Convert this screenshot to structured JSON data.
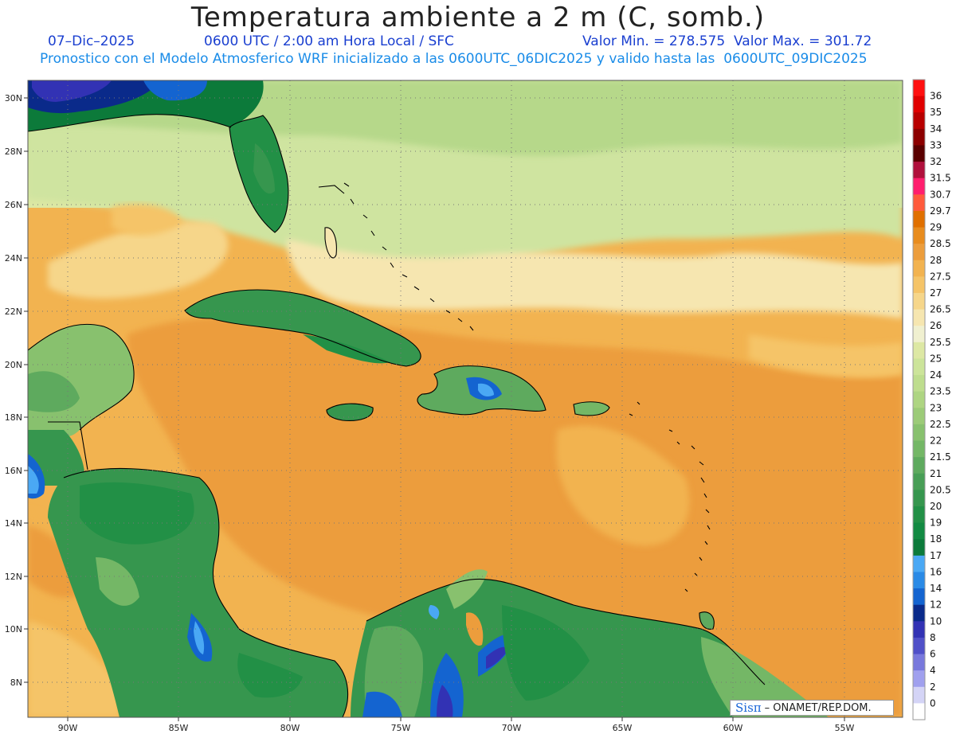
{
  "header": {
    "title": "Temperatura ambiente a 2 m (C, somb.)",
    "date": "07–Dic–2025",
    "time": "0600 UTC / 2:00 am Hora Local / SFC",
    "minmax": "Valor Min. = 278.575  Valor Max. = 301.72",
    "model_line": "Pronostico con el Modelo Atmosferico WRF inicializado a las 0600UTC_06DIC2025 y valido hasta las  0600UTC_09DIC2025"
  },
  "map": {
    "lat_labels": [
      "30N",
      "28N",
      "26N",
      "24N",
      "22N",
      "20N",
      "18N",
      "16N",
      "14N",
      "12N",
      "10N",
      "8N"
    ],
    "lon_labels": [
      "90W",
      "85W",
      "80W",
      "75W",
      "70W",
      "65W",
      "60W",
      "55W"
    ]
  },
  "colorbar": {
    "levels": [
      {
        "label": "36",
        "color": "#ff1010"
      },
      {
        "label": "35",
        "color": "#e00000"
      },
      {
        "label": "34",
        "color": "#b80000"
      },
      {
        "label": "33",
        "color": "#8c0000"
      },
      {
        "label": "32",
        "color": "#5a0000"
      },
      {
        "label": "31.5",
        "color": "#b0103c"
      },
      {
        "label": "30.7",
        "color": "#ff1e6e"
      },
      {
        "label": "29.7",
        "color": "#ff5a3c"
      },
      {
        "label": "29",
        "color": "#e07000"
      },
      {
        "label": "28.5",
        "color": "#e88c1e"
      },
      {
        "label": "28",
        "color": "#ec9d3c"
      },
      {
        "label": "27.5",
        "color": "#f2b350"
      },
      {
        "label": "27",
        "color": "#f5c468"
      },
      {
        "label": "26.5",
        "color": "#f6d68a"
      },
      {
        "label": "26",
        "color": "#f6e6b0"
      },
      {
        "label": "25.5",
        "color": "#f0f0d0"
      },
      {
        "label": "25",
        "color": "#dde8a4"
      },
      {
        "label": "24",
        "color": "#cce49a"
      },
      {
        "label": "23.5",
        "color": "#bedd8e"
      },
      {
        "label": "23",
        "color": "#aed582"
      },
      {
        "label": "22.5",
        "color": "#9ccb78"
      },
      {
        "label": "22",
        "color": "#88c16e"
      },
      {
        "label": "21.5",
        "color": "#74b766"
      },
      {
        "label": "21",
        "color": "#5eaa5e"
      },
      {
        "label": "20.5",
        "color": "#489e56"
      },
      {
        "label": "20",
        "color": "#36964e"
      },
      {
        "label": "19",
        "color": "#229046"
      },
      {
        "label": "18",
        "color": "#128a42"
      },
      {
        "label": "17",
        "color": "#0c7a3a"
      },
      {
        "label": "16",
        "color": "#4aa8f4"
      },
      {
        "label": "14",
        "color": "#2a8ae6"
      },
      {
        "label": "12",
        "color": "#1464d0"
      },
      {
        "label": "10",
        "color": "#0a2a8a"
      },
      {
        "label": "8",
        "color": "#3232b4"
      },
      {
        "label": "6",
        "color": "#5050c8"
      },
      {
        "label": "4",
        "color": "#7878dc"
      },
      {
        "label": "2",
        "color": "#a0a0ee"
      },
      {
        "label": "0",
        "color": "#d4d4f6"
      },
      {
        "label": "",
        "color": "#ffffff"
      }
    ]
  },
  "watermark": {
    "logo": "Sisπ",
    "text": "– ONAMET/REP.DOM."
  }
}
